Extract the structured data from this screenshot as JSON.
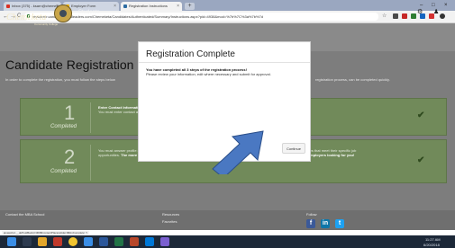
{
  "browser": {
    "tabs": [
      {
        "label": "Inbox (375) - ksarn@chemeka",
        "close": "×"
      },
      {
        "label": "Employer Form",
        "close": "×"
      },
      {
        "label": "Registration Instructions",
        "close": "×"
      }
    ],
    "new_tab": "+",
    "window_controls": {
      "minimize": "–",
      "maximize": "□",
      "close": "×"
    },
    "back": "←",
    "forward": "→",
    "reload": "C",
    "url": "mycareer.candidate.gradleaders.com/Chemeketa/Candidates/Authenticated/Summary/Instructions.aspx?pid=4938&mod=%7b%7C%3a%7b%7d",
    "star": "☆"
  },
  "site": {
    "logo": "Chemeketa",
    "logo_sub": "Community College",
    "nav_label": "Students",
    "header_icons": {
      "settings": "⚙",
      "user": "♟"
    }
  },
  "page": {
    "title": "Candidate Registration",
    "intro": "In order to complete the registration, you must follow the steps below",
    "intro_right": "registration process, can be completed quickly.",
    "steps": [
      {
        "number": "1",
        "status": "Completed",
        "text_bold": "Enter Contact Information",
        "text": "You must enter contact and"
      },
      {
        "number": "2",
        "status": "Completed",
        "text": "You must answer profile questions in order to be found in the system. These profile questions are used by employers to find candidates that meet their specific job opportunities.",
        "text_bold": "The more accurately and completely you fill out these questions, the more likely your profile will be found by employers looking for you!"
      }
    ],
    "footer": {
      "contact": "Contact the MBA School",
      "resources": "Resources",
      "resources_sub": "Favorites",
      "follow": "Follow"
    }
  },
  "status_bar_url": "javascript:__doPostBack('ctl00$ContentPlaceHolder1$btnComplete','')",
  "modal": {
    "title": "Registration Complete",
    "body_bold": "You have completed all 3 steps of the registration process!",
    "body": "Please review your information, edit where necessary and submit for approval.",
    "continue_label": "Continue"
  },
  "taskbar": {
    "time": "11:27 AM",
    "date": "6/20/2018"
  },
  "colors": {
    "step_green": "#718a5a",
    "check": "#2f4a1e",
    "arrow": "#4a78c2"
  }
}
